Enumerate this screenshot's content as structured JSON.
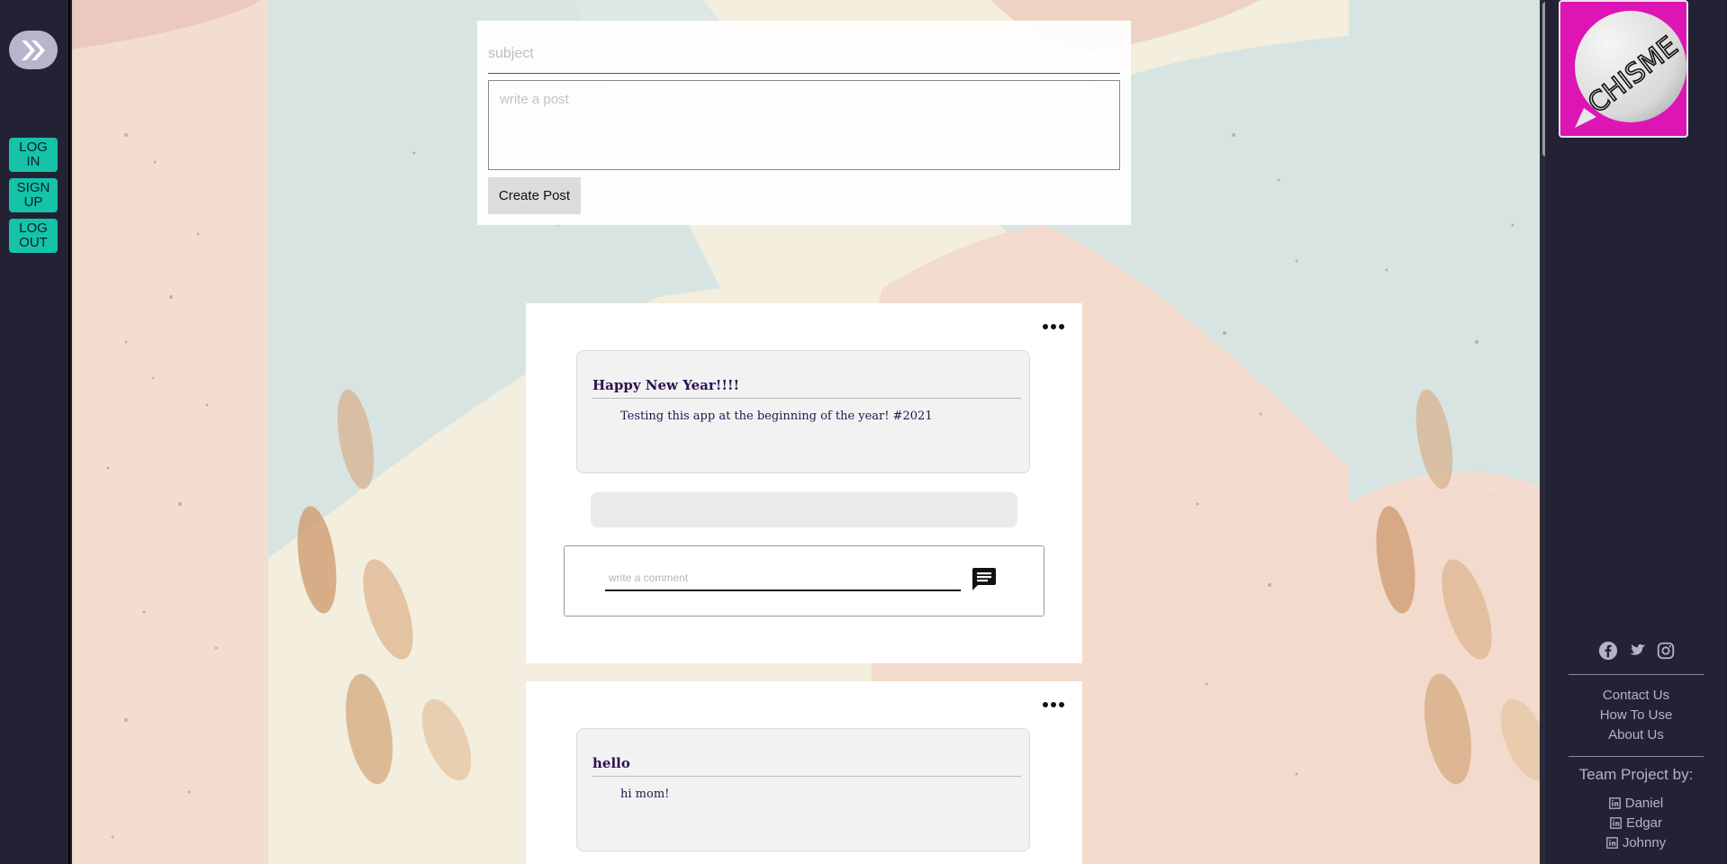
{
  "left_nav": {
    "expand_icon": "double-chevron-right-icon",
    "login_label_1": "LOG",
    "login_label_2": "IN",
    "signup_label_1": "SIGN",
    "signup_label_2": "UP",
    "logout_label_1": "LOG",
    "logout_label_2": "OUT"
  },
  "post_form": {
    "subject_placeholder": "subject",
    "body_placeholder": "write a post",
    "submit_label": "Create Post"
  },
  "posts": [
    {
      "title": "Happy New Year!!!!",
      "text": "Testing this app at the beginning of the year! #2021",
      "comment_placeholder": "write a comment"
    },
    {
      "title": "hello",
      "text": "hi mom!"
    }
  ],
  "sidebar": {
    "logo_text": "CHISME",
    "social": [
      "facebook-icon",
      "twitter-icon",
      "instagram-icon"
    ],
    "links": [
      "Contact Us",
      "How To Use",
      "About Us"
    ],
    "team_heading": "Team Project by:",
    "team": [
      "Daniel",
      "Edgar",
      "Johnny"
    ]
  },
  "colors": {
    "background_dark": "#232235",
    "accent_teal": "#14c3a8",
    "logo_magenta": "#dd15b4",
    "post_text": "#2b1150"
  }
}
